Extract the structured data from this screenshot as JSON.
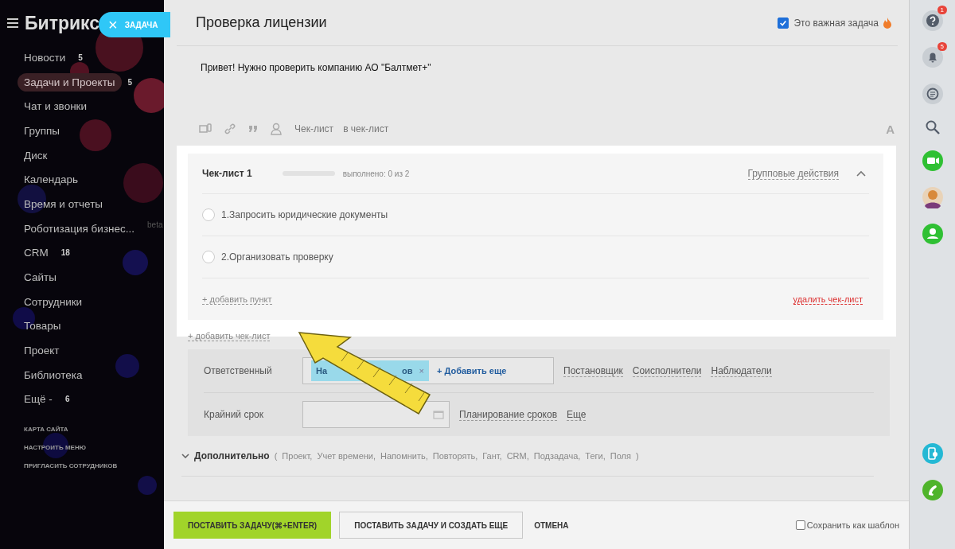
{
  "sidebar": {
    "logo": "Битрикс",
    "close_tab": {
      "icon": "×",
      "label": "ЗАДАЧА"
    },
    "items": [
      {
        "label": "Новости",
        "counter": "5",
        "selected": false
      },
      {
        "label": "Задачи и Проекты",
        "counter": "5",
        "selected": true
      },
      {
        "label": "Чат и звонки",
        "selected": false
      },
      {
        "label": "Группы",
        "selected": false
      },
      {
        "label": "Диск",
        "selected": false
      },
      {
        "label": "Календарь",
        "selected": false
      },
      {
        "label": "Время и отчеты",
        "selected": false
      },
      {
        "label": "Роботизация бизнес...",
        "tag": "beta",
        "selected": false
      },
      {
        "label": "CRM",
        "counter": "18",
        "selected": false
      },
      {
        "label": "Сайты",
        "selected": false
      },
      {
        "label": "Сотрудники",
        "selected": false
      },
      {
        "label": "Товары",
        "selected": false
      },
      {
        "label": "Проект",
        "selected": false
      },
      {
        "label": "Библиотека",
        "selected": false
      },
      {
        "label": "Ещё -",
        "counter": "6",
        "selected": false
      }
    ],
    "links": [
      "КАРТА САЙТА",
      "НАСТРОИТЬ МЕНЮ",
      "ПРИГЛАСИТЬ СОТРУДНИКОВ"
    ]
  },
  "task": {
    "title": "Проверка лицензии",
    "important": {
      "label": "Это важная задача",
      "checked": true
    },
    "description": "Привет! Нужно проверить компанию АО \"Балтмет+\"",
    "toolbar": {
      "links": [
        "Чек-лист",
        "в чек-лист"
      ],
      "format_button": "A"
    }
  },
  "checklist": {
    "title": "Чек-лист 1",
    "level": 0,
    "progress": "выполнено: 0 из 2",
    "group_actions": "Групповые действия",
    "expanded": true,
    "items": [
      {
        "text": "1.Запросить юридические документы",
        "checked": false
      },
      {
        "text": "2.Организовать проверку",
        "checked": false
      }
    ],
    "add_item": "+ добавить пункт",
    "delete": "удалить чек-лист"
  },
  "add_checklist": "+ добавить чек-лист",
  "fields": {
    "responsible": {
      "label": "Ответственный",
      "chip_start": "На",
      "chip_end": "ов",
      "chip_remove": "×",
      "add": "+ Добавить еще",
      "links": [
        "Постановщик",
        "Соисполнители",
        "Наблюдатели"
      ]
    },
    "deadline": {
      "label": "Крайний срок",
      "links": [
        "Планирование сроков",
        "Еще"
      ]
    }
  },
  "more": {
    "label": "Дополнительно",
    "open": "(",
    "items": [
      "Проект,",
      "Учет времени,",
      "Напомнить,",
      "Повторять,",
      "Гант,",
      "CRM,",
      "Подзадача,",
      "Теги,",
      "Поля"
    ],
    "close": ")"
  },
  "footer": {
    "submit": "ПОСТАВИТЬ ЗАДАЧУ(⌘+ENTER)",
    "submit_more": "ПОСТАВИТЬ ЗАДАЧУ И СОЗДАТЬ ЕЩЕ",
    "cancel": "ОТМЕНА",
    "template": {
      "label": "Сохранить как шаблон",
      "checked": false
    }
  },
  "right_bar": {
    "items": [
      {
        "kind": "help",
        "badge": "1"
      },
      {
        "kind": "bell",
        "badge": "5"
      },
      {
        "kind": "chat"
      },
      {
        "kind": "search"
      },
      {
        "kind": "video"
      },
      {
        "kind": "avatar"
      },
      {
        "kind": "person"
      },
      {
        "kind": "cloud-phone"
      },
      {
        "kind": "phone"
      }
    ]
  },
  "annotation": {
    "kind": "arrow"
  }
}
